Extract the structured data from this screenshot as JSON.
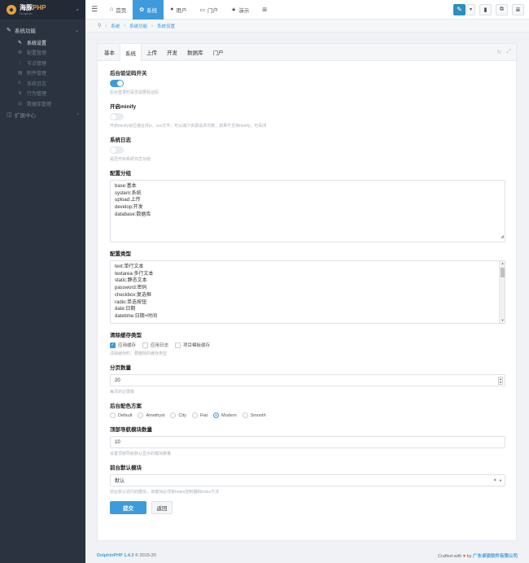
{
  "sidebar": {
    "logo": {
      "main": "海豚",
      "php": "PHP",
      "sub": "Dolphin"
    },
    "group_title": "系统功能",
    "items": [
      {
        "label": "系统设置",
        "icon": "wrench-icon",
        "active": true
      },
      {
        "label": "配置管理",
        "icon": "gear-icon"
      },
      {
        "label": "节点管理",
        "icon": "sitemap-icon"
      },
      {
        "label": "附件管理",
        "icon": "file-icon"
      },
      {
        "label": "系统日志",
        "icon": "log-icon"
      },
      {
        "label": "行为管理",
        "icon": "action-icon"
      },
      {
        "label": "数据库管理",
        "icon": "database-icon"
      }
    ],
    "group2_title": "扩展中心"
  },
  "topbar": {
    "nav": [
      {
        "label": "首页",
        "icon": "home-icon",
        "glyph": "⌂"
      },
      {
        "label": "系统",
        "icon": "gear-icon",
        "glyph": "✿",
        "active": true
      },
      {
        "label": "用户",
        "icon": "user-icon",
        "glyph": "●"
      },
      {
        "label": "门户",
        "icon": "laptop-icon",
        "glyph": "▭"
      },
      {
        "label": "演示",
        "icon": "star-icon",
        "glyph": "★"
      }
    ]
  },
  "breadcrumb": {
    "items": [
      "系统",
      "系统功能",
      "系统设置"
    ]
  },
  "tabs": [
    "基本",
    "系统",
    "上传",
    "开发",
    "数据库",
    "门户"
  ],
  "form": {
    "captcha": {
      "label": "后台验证码开关",
      "help": "后台登录时是否需要验证码"
    },
    "minify": {
      "label": "开启minify",
      "help": "开启minify会压缩合并js、css文件，可以减少资源请求次数，如果不支持minify，可关闭"
    },
    "syslog": {
      "label": "系统日志",
      "help": "是否开启系统日志功能"
    },
    "config_group": {
      "label": "配置分组",
      "lines": [
        "base:基本",
        "system:系统",
        "upload:上传",
        "develop:开发",
        "database:数据库"
      ]
    },
    "config_type": {
      "label": "配置类型",
      "lines": [
        "text:单行文本",
        "textarea:多行文本",
        "static:静态文本",
        "password:密码",
        "checkbox:复选框",
        "radio:单选按钮",
        "date:日期",
        "datetime:日期+时间"
      ]
    },
    "cache": {
      "label": "清除缓存类型",
      "options": [
        "应用缓存",
        "应用日志",
        "项目模板缓存"
      ],
      "help": "清除缓存时，要删除的缓存类型"
    },
    "page_size": {
      "label": "分页数量",
      "value": "20",
      "help": "每页的记录数"
    },
    "color_scheme": {
      "label": "后台配色方案",
      "options": [
        "Default",
        "Amethyst",
        "City",
        "Flat",
        "Modern",
        "Smooth"
      ]
    },
    "top_menu": {
      "label": "顶部导航模块数量",
      "value": "10",
      "help": "设置顶部导航默认显示的模块数量"
    },
    "home_module": {
      "label": "前台默认模块",
      "value": "默认",
      "help": "前台默认访问的模块，该模块必须有Index控制器和index方法"
    },
    "submit_label": "提交",
    "back_label": "返回"
  },
  "footer": {
    "brand": "DolphinPHP 1.4.3",
    "copy": "© 2015-20",
    "crafted": "Crafted with",
    "by": "by",
    "company": "广东卓锐软件有限公司"
  },
  "colors": {
    "accent": "#3d9bdb",
    "sidebar": "#2b3340"
  }
}
